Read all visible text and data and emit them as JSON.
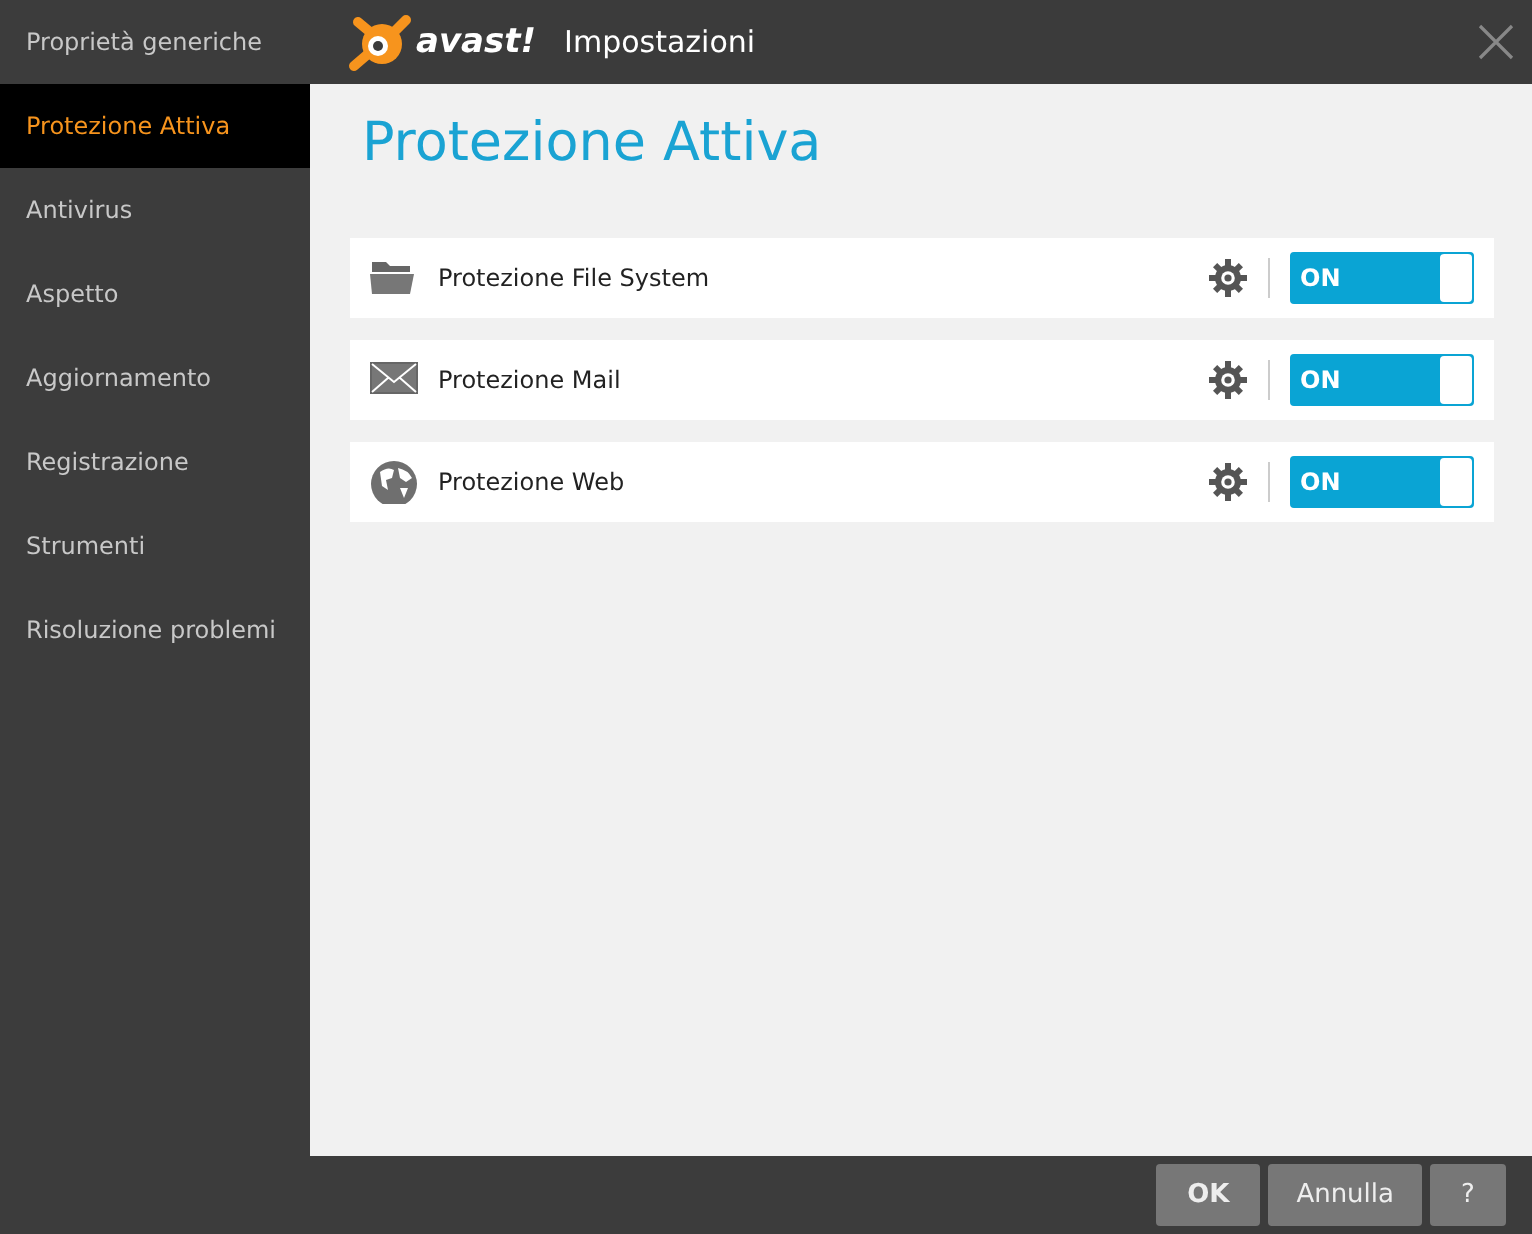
{
  "sidebar": {
    "items": [
      {
        "label": "Proprietà generiche",
        "selected": false
      },
      {
        "label": "Protezione Attiva",
        "selected": true
      },
      {
        "label": "Antivirus",
        "selected": false
      },
      {
        "label": "Aspetto",
        "selected": false
      },
      {
        "label": "Aggiornamento",
        "selected": false
      },
      {
        "label": "Registrazione",
        "selected": false
      },
      {
        "label": "Strumenti",
        "selected": false
      },
      {
        "label": "Risoluzione problemi",
        "selected": false
      }
    ]
  },
  "window": {
    "logo": "avast!",
    "title": "Impostazioni"
  },
  "page": {
    "heading": "Protezione Attiva",
    "shields": [
      {
        "kind": "folder",
        "label": "Protezione File System",
        "on": true,
        "toggle_label": "ON"
      },
      {
        "kind": "mail",
        "label": "Protezione Mail",
        "on": true,
        "toggle_label": "ON"
      },
      {
        "kind": "globe",
        "label": "Protezione Web",
        "on": true,
        "toggle_label": "ON"
      }
    ]
  },
  "buttons": [
    {
      "label": "OK",
      "kind": "primary"
    },
    {
      "label": "Annulla",
      "kind": "normal"
    },
    {
      "label": "?",
      "kind": "help"
    }
  ]
}
